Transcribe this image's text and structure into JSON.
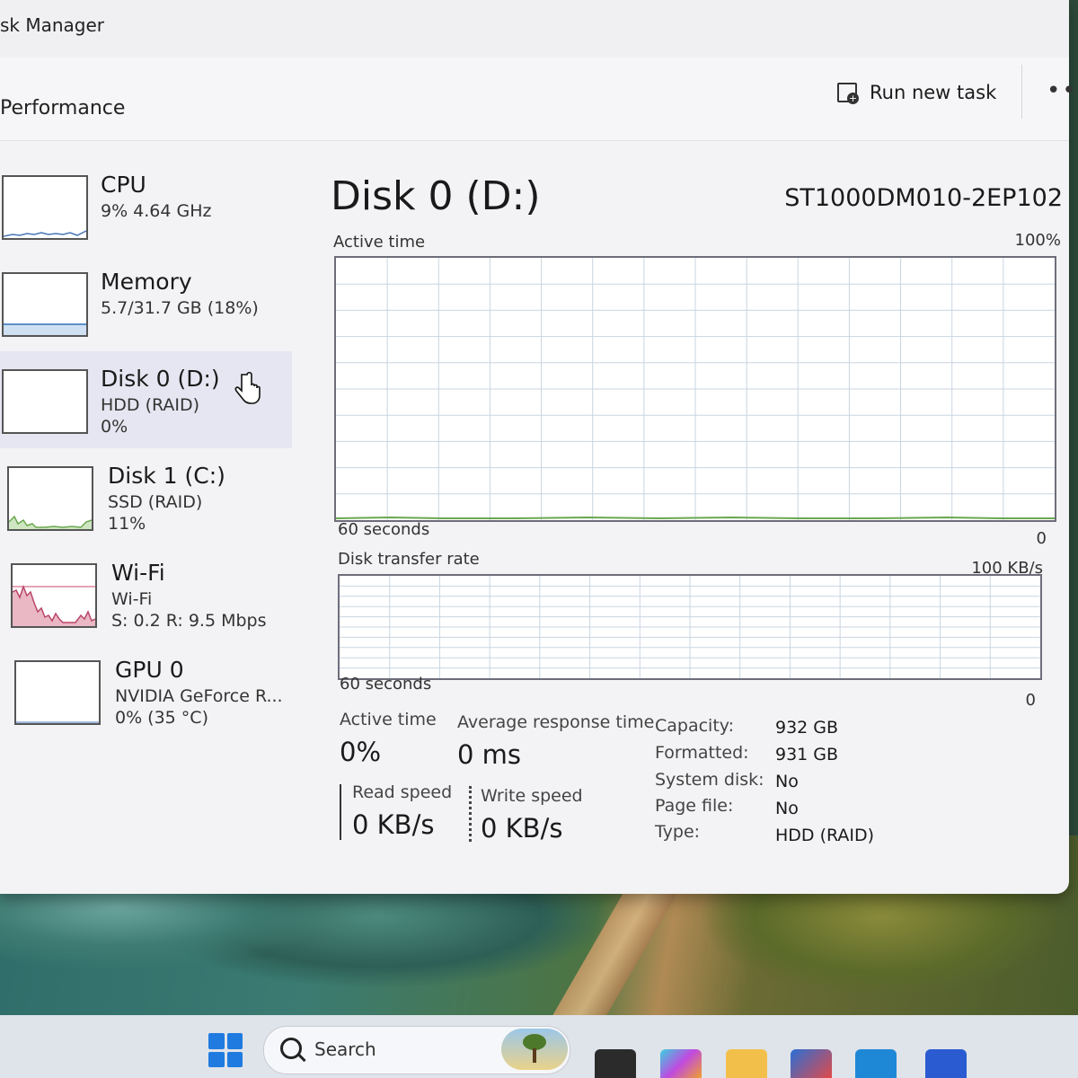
{
  "window": {
    "title": "sk Manager",
    "page_title": "Performance",
    "run_new_task": "Run new task",
    "more": "•••"
  },
  "sidebar": {
    "items": [
      {
        "name": "CPU",
        "sub": "9% 4.64 GHz",
        "sub2": ""
      },
      {
        "name": "Memory",
        "sub": "5.7/31.7 GB (18%)",
        "sub2": ""
      },
      {
        "name": "Disk 0 (D:)",
        "sub": "HDD (RAID)",
        "sub2": "0%"
      },
      {
        "name": "Disk 1 (C:)",
        "sub": "SSD (RAID)",
        "sub2": "11%"
      },
      {
        "name": "Wi-Fi",
        "sub": "Wi-Fi",
        "sub2": "S: 0.2 R: 9.5 Mbps"
      },
      {
        "name": "GPU 0",
        "sub": "NVIDIA GeForce R...",
        "sub2": "0% (35 °C)"
      }
    ]
  },
  "detail": {
    "title": "Disk 0 (D:)",
    "model": "ST1000DM010-2EP102",
    "active_time_graph": {
      "label": "Active time",
      "max": "100%",
      "time": "60 seconds",
      "min": "0"
    },
    "transfer_graph": {
      "label": "Disk transfer rate",
      "max": "100 KB/s",
      "time": "60 seconds",
      "min": "0"
    },
    "stats": {
      "active_time_label": "Active time",
      "active_time_value": "0%",
      "avg_response_label": "Average response time",
      "avg_response_value": "0 ms",
      "read_label": "Read speed",
      "read_value": "0 KB/s",
      "write_label": "Write speed",
      "write_value": "0 KB/s"
    },
    "properties": [
      {
        "key": "Capacity:",
        "value": "932 GB"
      },
      {
        "key": "Formatted:",
        "value": "931 GB"
      },
      {
        "key": "System disk:",
        "value": "No"
      },
      {
        "key": "Page file:",
        "value": "No"
      },
      {
        "key": "Type:",
        "value": "HDD (RAID)"
      }
    ]
  },
  "taskbar": {
    "search_placeholder": "Search"
  },
  "colors": {
    "disk_green": "#6aa84f",
    "wifi_pink": "#e2a6b6",
    "memory_blue": "#5b8fc9",
    "start_blue": "#1f7be0"
  }
}
